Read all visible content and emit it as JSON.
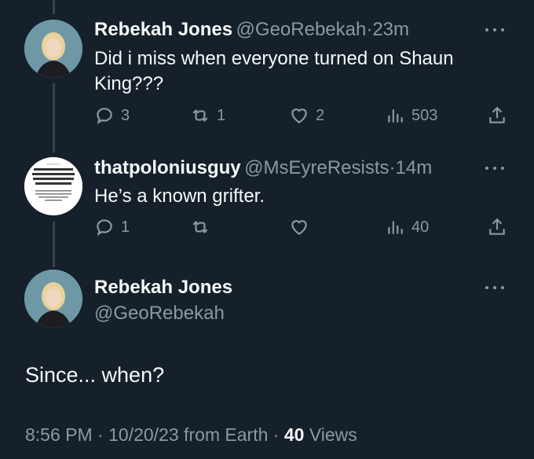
{
  "tweets": [
    {
      "name": "Rebekah Jones",
      "handle": "@GeoRebekah",
      "time": "23m",
      "text": "Did i miss when everyone turned on Shaun King???",
      "replies": "3",
      "retweets": "1",
      "likes": "2",
      "views": "503"
    },
    {
      "name": "thatpoloniusguy",
      "handle": "@MsEyreResists",
      "time": "14m",
      "text": "He’s a known grifter.",
      "replies": "1",
      "retweets": "",
      "likes": "",
      "views": "40",
      "avatar_text": "WHY REPUBLICAN INSIDERS THINK THE G.O.P. IS POISED FOR A BLOWOUT"
    }
  ],
  "main": {
    "name": "Rebekah Jones",
    "handle": "@GeoRebekah",
    "text": "Since... when?",
    "time": "8:56 PM",
    "date": "10/20/23",
    "source": "from Earth",
    "views_count": "40",
    "views_label": "Views"
  },
  "separator": "·",
  "colors": {
    "background": "#15202b",
    "muted": "#8b98a5",
    "text": "#f7f9f9"
  }
}
